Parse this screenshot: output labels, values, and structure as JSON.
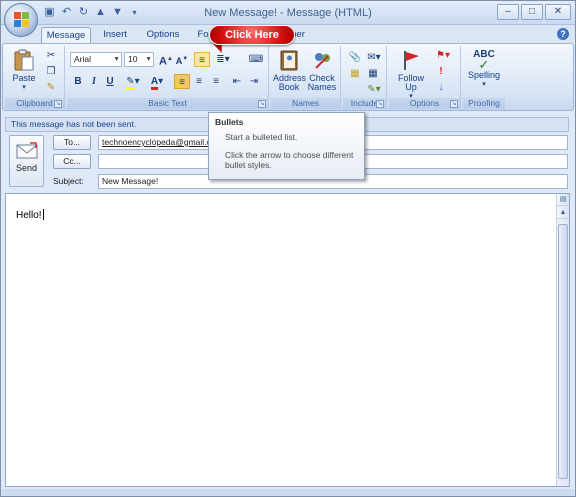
{
  "window": {
    "title": "New Message! - Message (HTML)",
    "min": "–",
    "max": "□",
    "close": "✕"
  },
  "qat": [
    "save-icon",
    "undo-icon",
    "redo-icon",
    "up-icon",
    "down-icon",
    "customize-icon"
  ],
  "tabs": {
    "message": "Message",
    "insert": "Insert",
    "options": "Options",
    "format": "Fo",
    "developer": "per"
  },
  "callout": "Click Here",
  "ribbon": {
    "clipboard": {
      "label": "Clipboard",
      "paste": "Paste"
    },
    "basic_text": {
      "label": "Basic Text",
      "font": "Arial",
      "size": "10",
      "bold": "B",
      "italic": "I",
      "underline": "U",
      "grow": "A",
      "shrink": "A"
    },
    "names": {
      "label": "Names",
      "address_book": "Address Book",
      "check_names": "Check Names"
    },
    "include": {
      "label": "Include"
    },
    "options": {
      "label": "Options",
      "follow_up": "Follow Up"
    },
    "proofing": {
      "label": "Proofing",
      "spelling": "Spelling",
      "abc": "ABC"
    }
  },
  "tooltip": {
    "title": "Bullets",
    "line1": "Start a bulleted list.",
    "line2": "Click the arrow to choose different bullet styles."
  },
  "infobar": "This message has not been sent.",
  "send": {
    "label": "Send"
  },
  "fields": {
    "to_button": "To...",
    "to_value": "technoencyclopeda@gmail.co",
    "cc_button": "Cc...",
    "cc_value": "",
    "subject_label": "Subject:",
    "subject_value": "New Message!"
  },
  "body": {
    "text": "Hello!"
  }
}
